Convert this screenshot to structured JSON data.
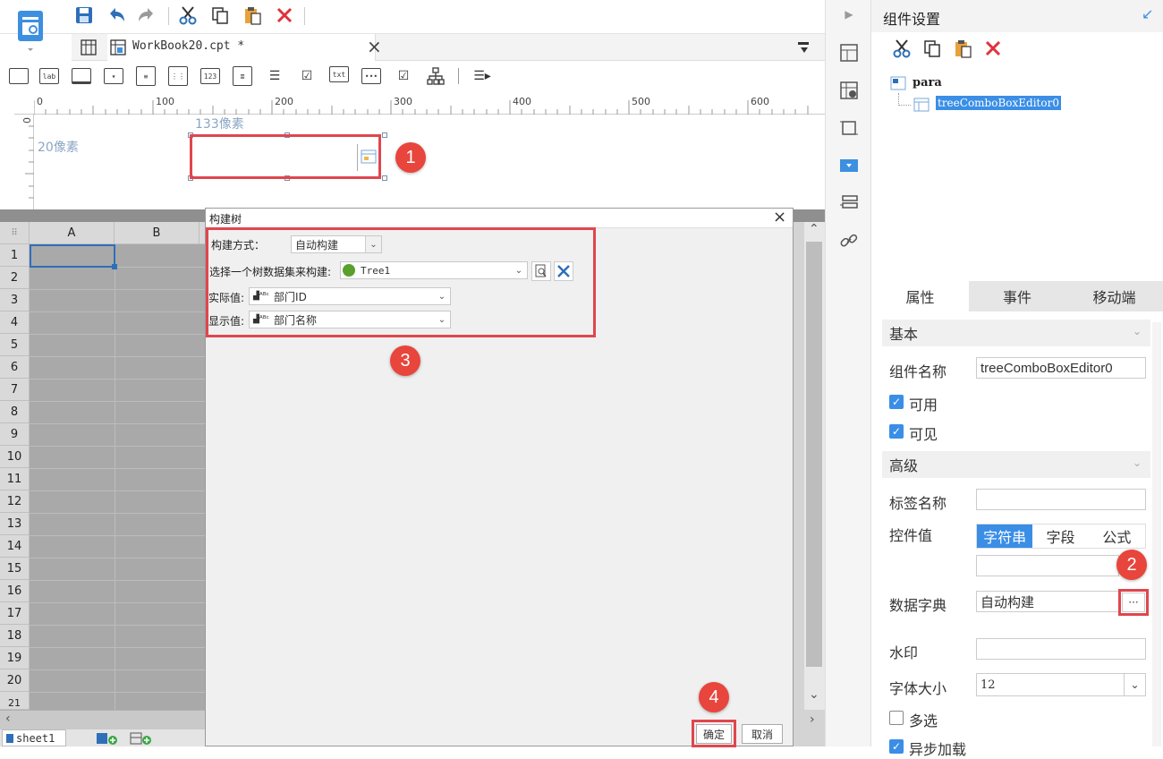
{
  "toolbar": {
    "icons": [
      "save-icon",
      "undo-icon",
      "redo-icon",
      "cut-icon",
      "copy-icon",
      "paste-icon",
      "delete-icon"
    ]
  },
  "tab": {
    "title": "WorkBook20.cpt *",
    "close": "×"
  },
  "widgets": [
    "lab",
    "123",
    "txt"
  ],
  "ruler": {
    "marks": [
      "0",
      "100",
      "200",
      "300",
      "400",
      "500",
      "600"
    ]
  },
  "canvas": {
    "width_label": "133像素",
    "height_label": "20像素"
  },
  "sheet": {
    "columns": [
      "A",
      "B"
    ],
    "rows": [
      "1",
      "2",
      "3",
      "4",
      "5",
      "6",
      "7",
      "8",
      "9",
      "10",
      "11",
      "12",
      "13",
      "14",
      "15",
      "16",
      "17",
      "18",
      "19",
      "20",
      "21"
    ],
    "tab_name": "sheet1"
  },
  "dialog": {
    "title": "构建树",
    "close": "×",
    "mode_label": "构建方式：",
    "mode_value": "自动构建",
    "dataset_label": "选择一个树数据集来构建:",
    "dataset_value": "Tree1",
    "actual_label": "实际值:",
    "actual_value": "部门ID",
    "display_label": "显示值:",
    "display_value": "部门名称",
    "ok": "确定",
    "cancel": "取消"
  },
  "panel": {
    "title": "组件设置",
    "tree_root": "para",
    "tree_child": "treeComboBoxEditor0",
    "tabs": [
      "属性",
      "事件",
      "移动端"
    ],
    "basic": "基本",
    "name_label": "组件名称",
    "name_value": "treeComboBoxEditor0",
    "enabled": "可用",
    "visible": "可见",
    "advanced": "高级",
    "label_name": "标签名称",
    "control_value": "控件值",
    "seg": [
      "字符串",
      "字段",
      "公式"
    ],
    "dict_label": "数据字典",
    "dict_value": "自动构建",
    "dict_btn": "···",
    "watermark": "水印",
    "font_size_label": "字体大小",
    "font_size_value": "12",
    "multi": "多选",
    "async": "异步加载"
  },
  "badges": [
    "1",
    "2",
    "3",
    "4"
  ],
  "colors": {
    "accent": "#3d8fe0",
    "highlight": "#e0464e",
    "badge": "#e8453c",
    "select": "#3a8ee6"
  }
}
